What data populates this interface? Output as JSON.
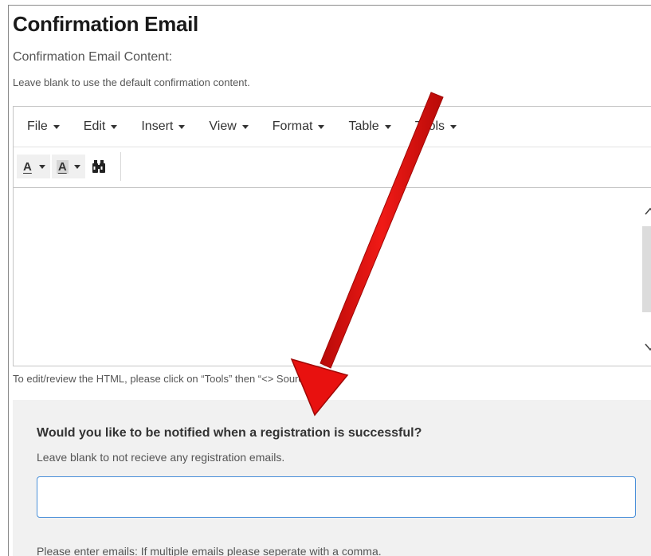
{
  "confirmation": {
    "title": "Confirmation Email",
    "content_label": "Confirmation Email Content:",
    "content_help": "Leave blank to use the default confirmation content."
  },
  "editor": {
    "menu": [
      {
        "label": "File"
      },
      {
        "label": "Edit"
      },
      {
        "label": "Insert"
      },
      {
        "label": "View"
      },
      {
        "label": "Format"
      },
      {
        "label": "Table"
      },
      {
        "label": "Tools"
      }
    ],
    "toolbar": {
      "text_color_label": "A",
      "background_color_label": "A",
      "find_icon": "binoculars-icon"
    },
    "body_text": "",
    "hint": "To edit/review the HTML, please click on “Tools” then “<> Source Code”"
  },
  "notifications": {
    "question": "Would you like to be notified when a registration is successful?",
    "help": "Leave blank to not recieve any registration emails.",
    "email_value": "",
    "note": "Please enter emails: If multiple emails please seperate with a comma."
  },
  "annotation": {
    "arrow_color": "#e8110f"
  }
}
